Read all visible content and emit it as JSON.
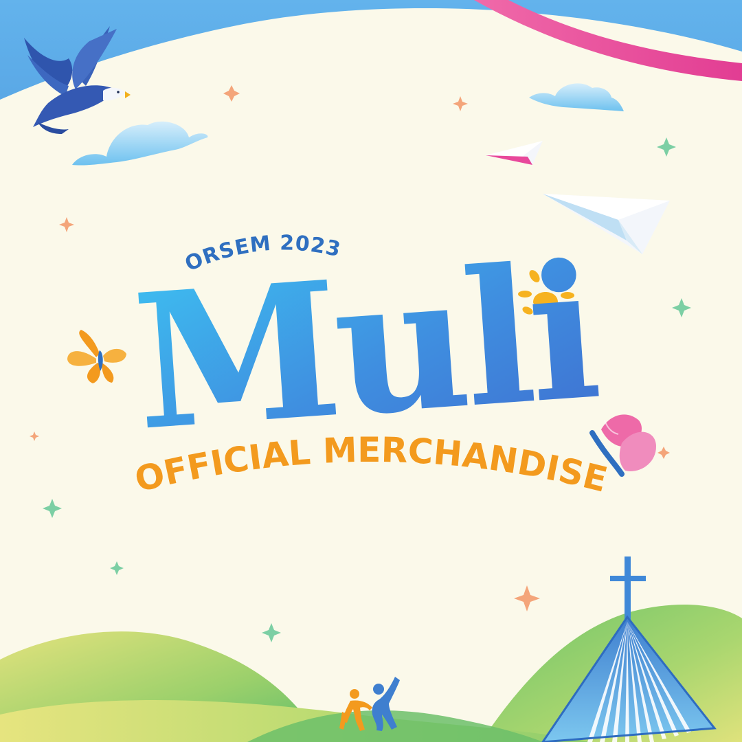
{
  "event": {
    "subtitle": "ORSEM 2023",
    "logo_text": "Muli",
    "tagline": "OFFICIAL MERCHANDISE"
  },
  "colors": {
    "background": "#fbf9ea",
    "sky_blue": "#5fb0ea",
    "logo_blue": "#3f8fe0",
    "logo_blue_light": "#3ec3f2",
    "tagline_orange": "#f39a1e",
    "subtitle_blue": "#2f6fc0",
    "ribbon_pink": "#e8489b",
    "hill_green": "#7ec66a",
    "hill_yellow": "#d8e27a"
  },
  "icons": [
    "eagle-icon",
    "cloud-icon",
    "paper-plane-icon",
    "butterfly-icon",
    "sun-icon",
    "sparkle-icon",
    "church-cross-icon",
    "people-figures-icon"
  ]
}
